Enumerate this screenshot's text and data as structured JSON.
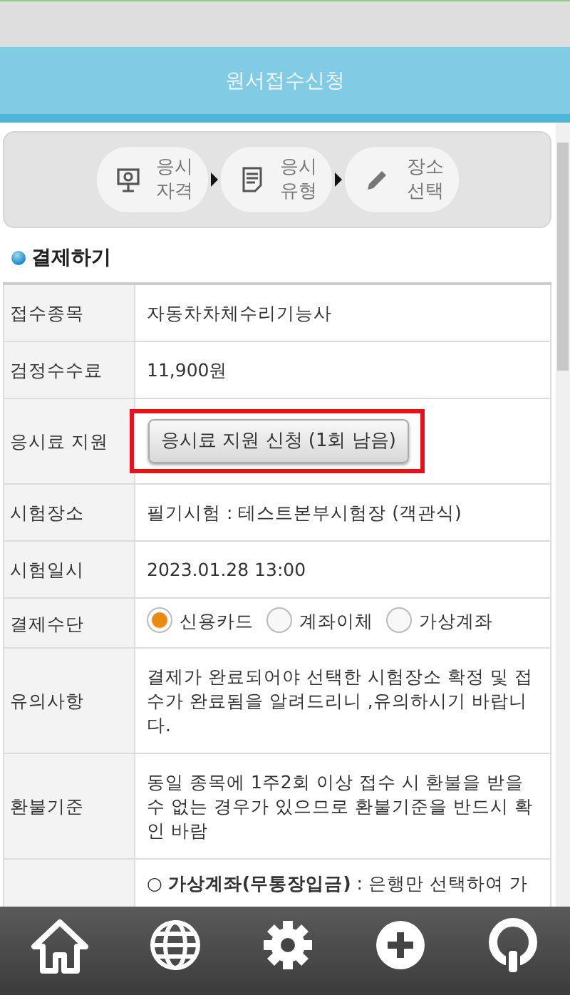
{
  "header": {
    "title": "원서접수신청"
  },
  "steps": [
    {
      "line1": "응시",
      "line2": "자격"
    },
    {
      "line1": "응시",
      "line2": "유형"
    },
    {
      "line1": "장소",
      "line2": "선택"
    }
  ],
  "section": {
    "title": "결제하기"
  },
  "rows": [
    {
      "label": "접수종목",
      "kind": "text",
      "value": "자동차차체수리기능사"
    },
    {
      "label": "검정수수료",
      "kind": "text",
      "value": "11,900원"
    },
    {
      "label": "응시료 지원",
      "kind": "button",
      "value": "응시료 지원 신청 (1회 남음)",
      "highlighted": true
    },
    {
      "label": "시험장소",
      "kind": "text",
      "value": "필기시험 : 테스트본부시험장 (객관식)"
    },
    {
      "label": "시험일시",
      "kind": "text",
      "value": "2023.01.28 13:00"
    },
    {
      "label": "결제수단",
      "kind": "radio",
      "options": [
        {
          "label": "신용카드",
          "selected": true
        },
        {
          "label": "계좌이체",
          "selected": false
        },
        {
          "label": "가상계좌",
          "selected": false
        }
      ]
    },
    {
      "label": "유의사항",
      "kind": "text",
      "value": "결제가 완료되어야 선택한 시험장소 확정 및 접수가 완료됨을 알려드리니 ,유의하시기 바랍니다."
    },
    {
      "label": "환불기준",
      "kind": "text",
      "value": "동일 종목에 1주2회 이상 접수 시 환불을 받을 수 없는 경우가 있으므로 환불기준을 반드시 확인 바람"
    },
    {
      "kind": "text",
      "value": "○ **가상계좌(무통장입금)** : 은행만 선택하여 가"
    }
  ]
}
